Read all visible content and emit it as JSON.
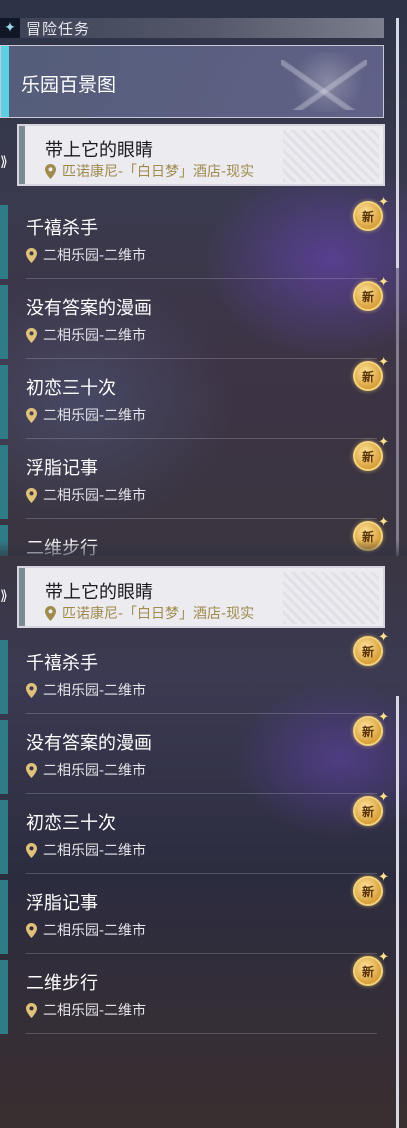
{
  "header": {
    "icon": "diamond-sparkle-icon",
    "title": "冒险任务"
  },
  "category": {
    "title": "乐园百景图"
  },
  "selected_quest": {
    "name": "带上它的眼睛",
    "location": "匹诺康尼-「白日梦」酒店-现实"
  },
  "badge_label": "新",
  "quests_top": [
    {
      "name": "千禧杀手",
      "location": "二相乐园-二维市"
    },
    {
      "name": "没有答案的漫画",
      "location": "二相乐园-二维市"
    },
    {
      "name": "初恋三十次",
      "location": "二相乐园-二维市"
    },
    {
      "name": "浮脂记事",
      "location": "二相乐园-二维市"
    },
    {
      "name": "二维步行",
      "location": ""
    }
  ],
  "quests_bottom": [
    {
      "name": "千禧杀手",
      "location": "二相乐园-二维市"
    },
    {
      "name": "没有答案的漫画",
      "location": "二相乐园-二维市"
    },
    {
      "name": "初恋三十次",
      "location": "二相乐园-二维市"
    },
    {
      "name": "浮脂记事",
      "location": "二相乐园-二维市"
    },
    {
      "name": "二维步行",
      "location": "二相乐园-二维市"
    }
  ],
  "colors": {
    "accent_cyan": "#5ed0e6",
    "quest_bar": "#2f7c86",
    "badge_gold": "#d8a03a",
    "location_gold": "#a08a4c"
  }
}
